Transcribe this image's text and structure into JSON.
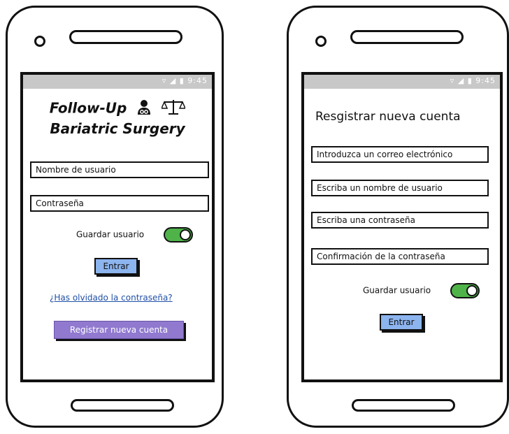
{
  "status_bar": {
    "time": "9:45"
  },
  "login": {
    "title_line1": "Follow-Up",
    "title_line2": "Bariatric Surgery",
    "username_placeholder": "Nombre de usuario",
    "password_placeholder": "Contraseña",
    "remember_label": "Guardar usuario",
    "remember_on": true,
    "enter_button": "Entrar",
    "forgot_link": "¿Has olvidado la contraseña?",
    "register_button": "Registrar nueva cuenta"
  },
  "register": {
    "title": "Resgistrar nueva cuenta",
    "email_placeholder": "Introduzca un correo electrónico",
    "username_placeholder": "Escriba un nombre de usuario",
    "password_placeholder": "Escriba una contraseña",
    "confirm_placeholder": "Confirmación de la contraseña",
    "remember_label": "Guardar usuario",
    "remember_on": true,
    "enter_button": "Entrar"
  },
  "colors": {
    "status_bar": "#c8c8c8",
    "toggle_on": "#4fb34a",
    "enter_button": "#8cb4ee",
    "register_button": "#9079cf",
    "link": "#1f4fa6"
  },
  "icons": [
    "speaker-icon",
    "wifi-icon",
    "signal-icon",
    "battery-icon",
    "doctor-icon",
    "scale-icon"
  ]
}
